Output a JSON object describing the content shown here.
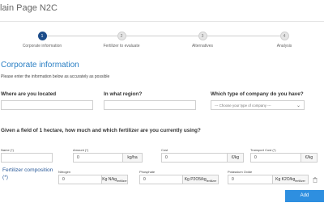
{
  "page": {
    "title": "lain Page N2C"
  },
  "stepper": {
    "steps": [
      {
        "number": "1",
        "label": "Corporate information",
        "active": true
      },
      {
        "number": "2",
        "label": "Fertilizer to evaluate",
        "active": false
      },
      {
        "number": "3",
        "label": "Alternatives",
        "active": false
      },
      {
        "number": "4",
        "label": "Analysis",
        "active": false
      }
    ]
  },
  "corporate": {
    "title": "Corporate information",
    "subtitle": "Please enter the information below as accurately as possible",
    "location_label": "Where are you located",
    "region_label": "In what region?",
    "company_label": "Which type of company do you have?",
    "company_placeholder": "--- Choose your type of company ---"
  },
  "fertilizer": {
    "question": "Given a field of 1 hectare, how much and which fertilizer are you currently using?",
    "name_label": "Name (*)",
    "amount_label": "Amount (*)",
    "amount_value": "0",
    "amount_unit": "kg/ha",
    "cost_label": "Cost",
    "cost_value": "0",
    "cost_unit": "€/kg",
    "transport_label": "Transport Cost (*)",
    "transport_value": "0",
    "transport_unit": "€/kg",
    "composition_label": "Fertilizer composition",
    "composition_required": "(*)",
    "nitrogen_label": "Nitrogen",
    "nitrogen_value": "0",
    "nitrogen_unit_main": "Kg N/kg",
    "nitrogen_unit_sub": "fertilizer",
    "phosphate_label": "Phosphate",
    "phosphate_value": "0",
    "phosphate_unit_main": "Kg P2O5/kg",
    "phosphate_unit_sub": "fertilizer",
    "potassium_label": "Potassium Oxide",
    "potassium_value": "0",
    "potassium_unit_main": "Kg K2O/kg",
    "potassium_unit_sub": "fertilizer"
  },
  "actions": {
    "add_label": "Add"
  },
  "icons": {
    "trash": "trash-icon",
    "chevron": "chevron-down-icon"
  },
  "colors": {
    "accent": "#2a7fc4",
    "active_step": "#1c4d8a",
    "button": "#2e8fe0"
  }
}
